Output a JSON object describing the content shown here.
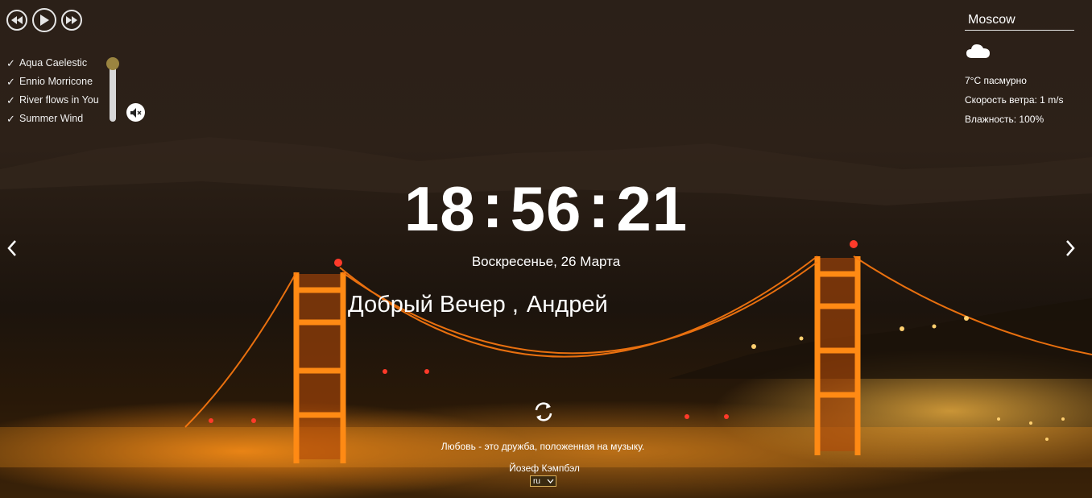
{
  "player": {
    "controls": [
      {
        "name": "rewind-button",
        "icon": "rewind-icon"
      },
      {
        "name": "play-button",
        "icon": "play-icon"
      },
      {
        "name": "fast-forward-button",
        "icon": "fast-forward-icon"
      }
    ],
    "playlist": [
      {
        "check": "✓",
        "title": "Aqua Caelestic"
      },
      {
        "check": "✓",
        "title": "Ennio Morricone"
      },
      {
        "check": "✓",
        "title": "River flows in You"
      },
      {
        "check": "✓",
        "title": "Summer Wind"
      }
    ],
    "volume_level": 1.0,
    "mute_icon": "speaker-muted-icon"
  },
  "weather": {
    "city": "Moscow",
    "icon": "cloud-icon",
    "condition": "7°C пасмурно",
    "wind": "Скорость ветра: 1 m/s",
    "humidity": "Влажность: 100%"
  },
  "clock": {
    "hours": "18",
    "minutes": "56",
    "seconds": "21",
    "separator": ":"
  },
  "date": "Воскресенье, 26 Марта",
  "greeting": {
    "text": "Добрый Вечер ,",
    "name": "Андрей"
  },
  "navigation": {
    "prev_icon": "chevron-left-icon",
    "next_icon": "chevron-right-icon",
    "refresh_icon": "refresh-icon"
  },
  "quote": {
    "text": "Любовь - это дружба, положенная на музыку.",
    "author": "Йозеф Кэмпбэл"
  },
  "language": {
    "selected": "ru"
  },
  "colors": {
    "volume_knob": "#9a8440",
    "text": "#ffffff"
  }
}
